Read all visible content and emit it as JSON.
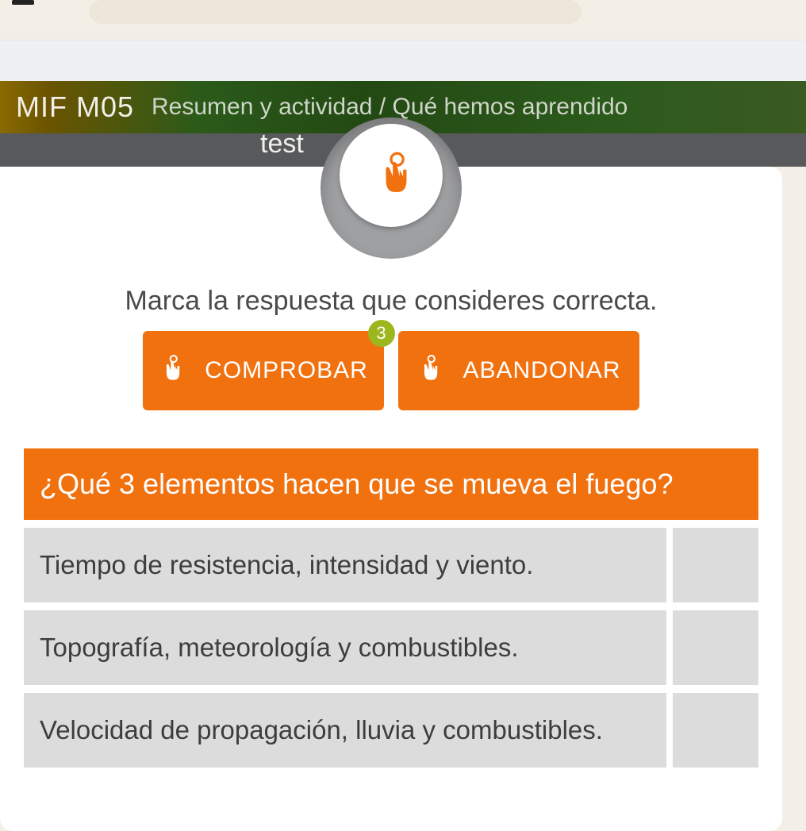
{
  "header": {
    "course_code": "MIF M05"
  },
  "breadcrumb": {
    "path": "Resumen y actividad / Qué hemos aprendido"
  },
  "subtitle": "test",
  "instruction_text": "Marca la respuesta que consideres correcta.",
  "buttons": {
    "check_label": "COMPROBAR",
    "abandon_label": "ABANDONAR",
    "attempts_badge": "3"
  },
  "question": {
    "prompt": "¿Qué 3 elementos hacen que se mueva el fuego?",
    "answers": [
      "Tiempo de resistencia, intensidad y viento.",
      "Topografía, meteorología y combustibles.",
      "Velocidad de propagación, lluvia y combustibles."
    ]
  }
}
